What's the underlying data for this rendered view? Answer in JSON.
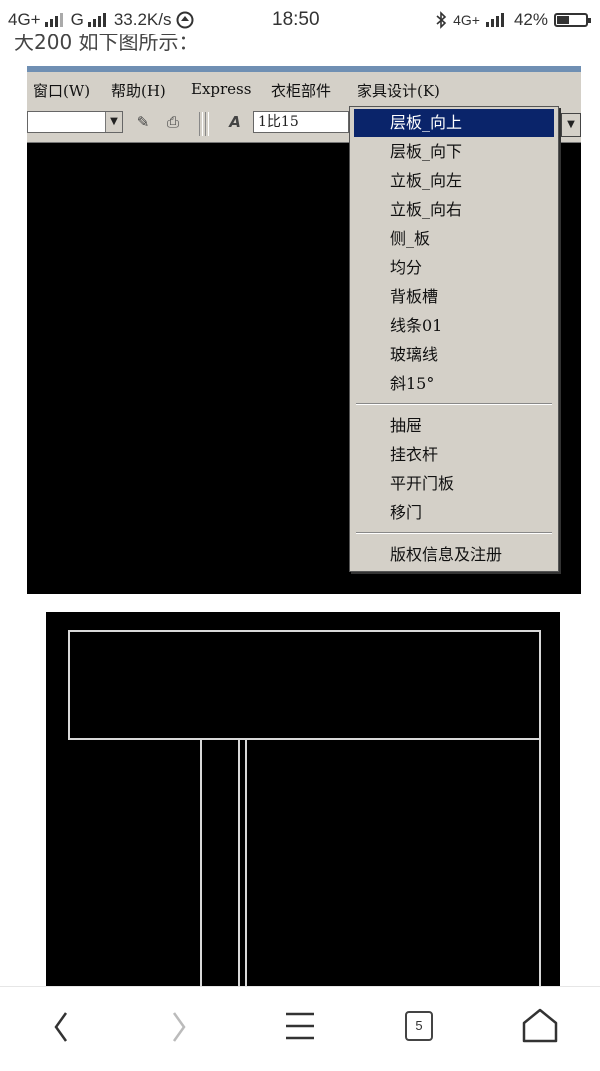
{
  "status_bar": {
    "network_1": "4G+",
    "network_2": "G",
    "speed": "33.2K/s",
    "time": "18:50",
    "network_3": "4G+",
    "battery": "42%",
    "battery_level": 0.42
  },
  "article_cut_text": "大200 如下图所示：",
  "cad_window": {
    "menu": [
      {
        "label": "窗口(W)"
      },
      {
        "label": "帮助(H)"
      },
      {
        "label": "Express"
      },
      {
        "label": "衣柜部件"
      },
      {
        "label": "家具设计(K)"
      }
    ],
    "scale_value": "1比15",
    "dropdown_items": [
      {
        "label": "层板_向上",
        "active": true
      },
      {
        "label": "层板_向下"
      },
      {
        "label": "立板_向左"
      },
      {
        "label": "立板_向右"
      },
      {
        "label": "侧_板"
      },
      {
        "label": "均分"
      },
      {
        "label": "背板槽"
      },
      {
        "label": "线条01"
      },
      {
        "label": "玻璃线"
      },
      {
        "label": "斜15°"
      },
      {
        "label": "抽屉"
      },
      {
        "label": "挂衣杆"
      },
      {
        "label": "平开门板"
      },
      {
        "label": "移门"
      },
      {
        "label": "版权信息及注册"
      }
    ],
    "highlight_color": "#0a246a"
  },
  "nav": {
    "tab_count": "5"
  }
}
